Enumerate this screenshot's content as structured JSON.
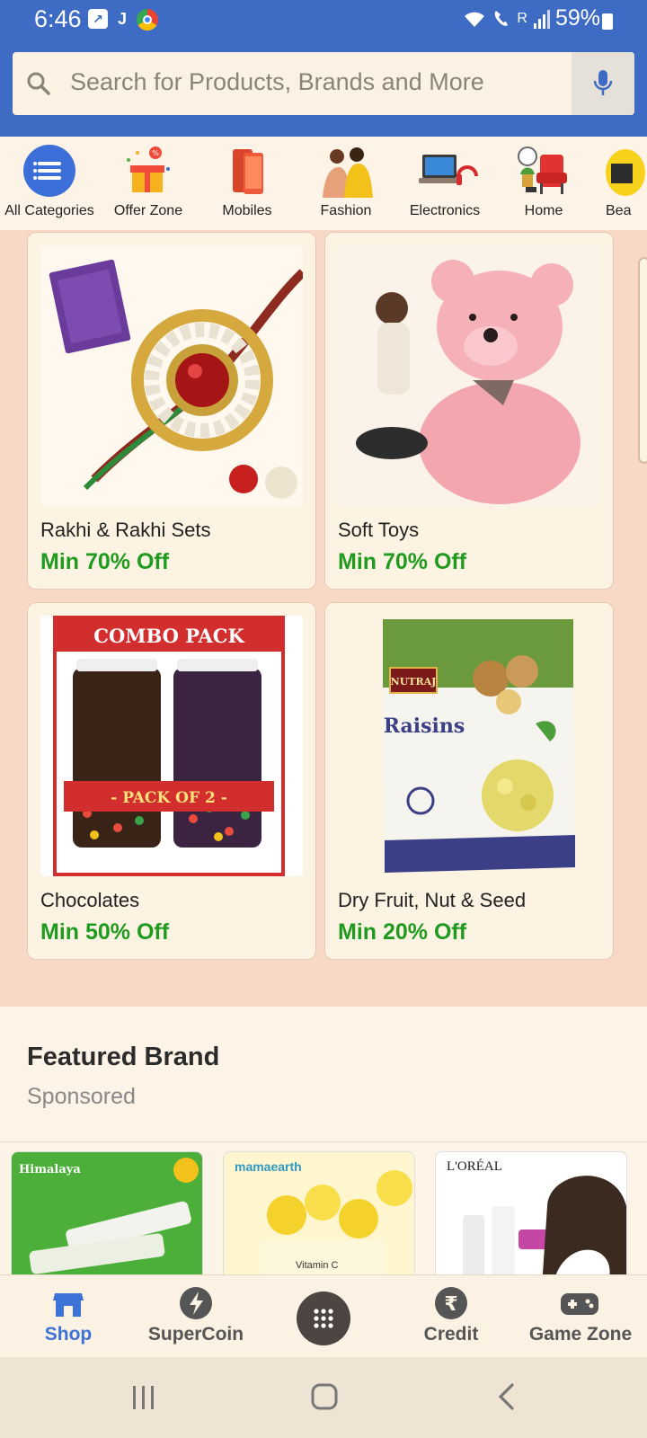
{
  "status_bar": {
    "time": "6:46",
    "battery": "59%",
    "network_label": "R"
  },
  "search": {
    "placeholder": "Search for Products, Brands and More"
  },
  "categories": [
    {
      "label": "All Categories",
      "icon": "list-icon"
    },
    {
      "label": "Offer Zone",
      "icon": "gift-icon"
    },
    {
      "label": "Mobiles",
      "icon": "mobile-phone-icon"
    },
    {
      "label": "Fashion",
      "icon": "fashion-couple-icon"
    },
    {
      "label": "Electronics",
      "icon": "laptop-headphones-icon"
    },
    {
      "label": "Home",
      "icon": "chair-plant-icon"
    },
    {
      "label": "Bea",
      "icon": "beauty-icon"
    }
  ],
  "deals": [
    {
      "name": "Rakhi & Rakhi Sets",
      "offer": "Min 70% Off",
      "image": "rakhi-image"
    },
    {
      "name": "Soft Toys",
      "offer": "Min 70% Off",
      "image": "teddy-bear-image"
    },
    {
      "name": "Chocolates",
      "offer": "Min 50% Off",
      "image": "candy-jars-image",
      "image_text": {
        "banner": "COMBO PACK",
        "ribbon": "- PACK OF 2 -"
      }
    },
    {
      "name": "Dry Fruit, Nut & Seed",
      "offer": "Min 20% Off",
      "image": "raisins-pack-image",
      "image_text": {
        "brand": "NUTRAJ",
        "product": "Raisins"
      }
    }
  ],
  "featured": {
    "title": "Featured Brand",
    "subtitle": "Sponsored",
    "brands": [
      {
        "name": "Himalaya",
        "color": "#4caf3a"
      },
      {
        "name": "mamaearth",
        "color": "#fff6d0",
        "caption": "Vitamin C"
      },
      {
        "name": "L'ORÉAL",
        "color": "#ffffff"
      }
    ]
  },
  "bottom_nav": [
    {
      "label": "Shop",
      "icon": "shop-icon",
      "active": true
    },
    {
      "label": "SuperCoin",
      "icon": "supercoin-icon",
      "active": false
    },
    {
      "label": "",
      "icon": "grid-menu-icon",
      "active": false
    },
    {
      "label": "Credit",
      "icon": "rupee-icon",
      "active": false
    },
    {
      "label": "Game Zone",
      "icon": "gamepad-icon",
      "active": false
    }
  ],
  "colors": {
    "header_blue": "#3e6bc4",
    "offer_green": "#1f9b1f",
    "active_blue": "#3d72d6"
  }
}
